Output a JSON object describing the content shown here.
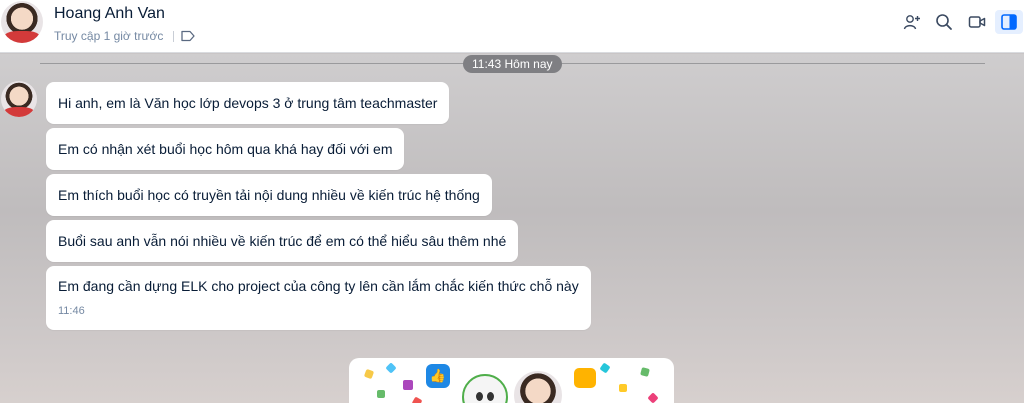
{
  "header": {
    "contact_name": "Hoang Anh Van",
    "last_seen": "Truy cập 1 giờ trước"
  },
  "chat": {
    "time_separator": "11:43 Hôm nay",
    "messages": [
      {
        "text": "Hi anh, em là Văn học lớp devops 3 ở trung tâm teachmaster"
      },
      {
        "text": "Em có nhận xét buổi học hôm qua khá hay đối với em"
      },
      {
        "text": "Em thích buổi học có truyền tải nội dung nhiều về kiến trúc hệ thống"
      },
      {
        "text": "Buổi sau anh vẫn nói nhiều về kiến trúc để em có thể hiểu sâu thêm nhé"
      },
      {
        "text": "Em đang cần dựng ELK cho project của công ty lên cần lắm chắc kiến thức chỗ này",
        "time": "11:46"
      }
    ]
  },
  "icons": [
    "add-friend-icon",
    "search-icon",
    "video-call-icon",
    "sidebar-toggle-icon",
    "tag-icon"
  ],
  "colors": {
    "accent": "#0068ff",
    "name_text": "#081c36",
    "muted_text": "#7589a3",
    "time_pill_bg": "#7f7f83"
  }
}
